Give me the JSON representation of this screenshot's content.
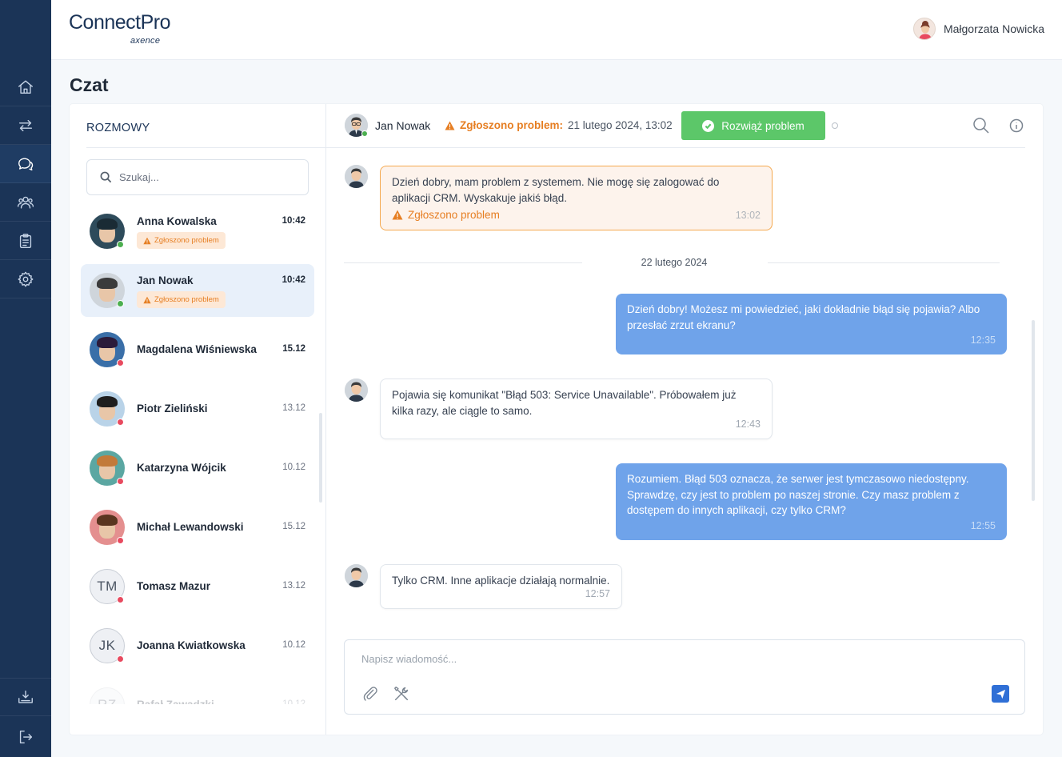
{
  "brand": {
    "name": "ConnectPro",
    "sub": "axence"
  },
  "user": {
    "name": "Małgorzata Nowicka"
  },
  "page": {
    "title": "Czat"
  },
  "nav": [
    {
      "icon": "home-icon",
      "label": "Home"
    },
    {
      "icon": "transfer-icon",
      "label": "Transfer"
    },
    {
      "icon": "chat-icon",
      "label": "Chat"
    },
    {
      "icon": "users-icon",
      "label": "Users"
    },
    {
      "icon": "clipboard-icon",
      "label": "Tasks"
    },
    {
      "icon": "gear-icon",
      "label": "Settings"
    },
    {
      "icon": "download-icon",
      "label": "Download"
    },
    {
      "icon": "logout-icon",
      "label": "Logout"
    }
  ],
  "conversations": {
    "header": "ROZMOWY",
    "search_placeholder": "Szukaj...",
    "items": [
      {
        "name": "Anna Kowalska",
        "time": "10:42",
        "badge": "Zgłoszono problem",
        "status": "online",
        "bold_time": true,
        "skin": "#2e4b5b",
        "hair": "#1a2b35"
      },
      {
        "name": "Jan Nowak",
        "time": "10:42",
        "badge": "Zgłoszono problem",
        "status": "online",
        "bold_time": true,
        "skin": "#cfd5db",
        "hair": "#3b3b3b"
      },
      {
        "name": "Magdalena Wiśniewska",
        "time": "15.12",
        "badge": "",
        "status": "offline",
        "bold_time": true,
        "skin": "#3a6fa8",
        "hair": "#2b1b3a"
      },
      {
        "name": "Piotr Zieliński",
        "time": "13.12",
        "badge": "",
        "status": "offline",
        "bold_time": false,
        "skin": "#b9d3e8",
        "hair": "#1e1e1e"
      },
      {
        "name": "Katarzyna Wójcik",
        "time": "10.12",
        "badge": "",
        "status": "offline",
        "bold_time": false,
        "skin": "#5ba7a2",
        "hair": "#c27a3a"
      },
      {
        "name": "Michał Lewandowski",
        "time": "15.12",
        "badge": "",
        "status": "offline",
        "bold_time": false,
        "skin": "#e48f8f",
        "hair": "#5a3520"
      },
      {
        "name": "Tomasz Mazur",
        "time": "13.12",
        "badge": "",
        "status": "offline",
        "bold_time": false,
        "initials": "TM"
      },
      {
        "name": "Joanna Kwiatkowska",
        "time": "10.12",
        "badge": "",
        "status": "offline",
        "bold_time": false,
        "initials": "JK"
      },
      {
        "name": "Rafał Zawadzki",
        "time": "10.12",
        "badge": "",
        "status": "offline",
        "bold_time": false,
        "initials": "RZ"
      }
    ]
  },
  "chat": {
    "contact": "Jan Nowak",
    "alert_label": "Zgłoszono problem:",
    "alert_date": "21 lutego 2024, 13:02",
    "resolve_label": "Rozwiąż problem",
    "date_separator": "22 lutego 2024",
    "messages": [
      {
        "dir": "in",
        "alert": true,
        "text": "Dzień dobry, mam problem z systemem. Nie mogę się zalogować do aplikacji CRM. Wyskakuje jakiś błąd.",
        "flag": "Zgłoszono problem",
        "time": "13:02"
      },
      {
        "dir": "out",
        "text": "Dzień dobry! Możesz mi powiedzieć, jaki dokładnie błąd się pojawia? Albo przesłać zrzut ekranu?",
        "time": "12:35"
      },
      {
        "dir": "in",
        "text": "Pojawia się komunikat \"Błąd 503: Service Unavailable\". Próbowałem już kilka razy, ale ciągle to samo.",
        "time": "12:43"
      },
      {
        "dir": "out",
        "text": "Rozumiem. Błąd 503 oznacza, że serwer jest tymczasowo niedostępny. Sprawdzę, czy jest to problem po naszej stronie. Czy masz problem z dostępem do innych aplikacji, czy tylko CRM?",
        "time": "12:55"
      },
      {
        "dir": "in",
        "text": "Tylko CRM. Inne aplikacje działają normalnie.",
        "time": "12:57"
      }
    ],
    "composer_placeholder": "Napisz wiadomość..."
  },
  "colors": {
    "rail": "#1b3457",
    "accent": "#2f6fd6",
    "out_bubble": "#6fa3ea",
    "alert": "#e67e22",
    "success": "#5cc769",
    "online": "#4caf50",
    "offline": "#e84a5f"
  }
}
